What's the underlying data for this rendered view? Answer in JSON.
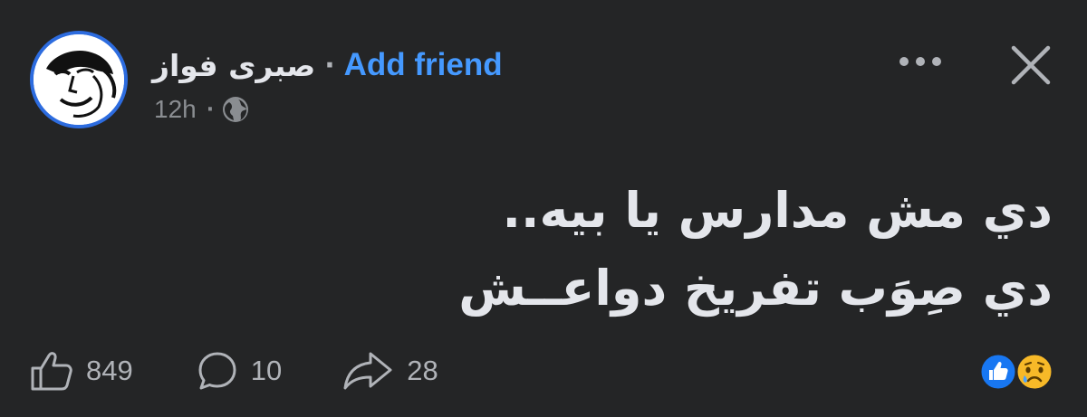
{
  "post": {
    "author_name": "صبرى فواز",
    "separator": "·",
    "add_friend_label": "Add friend",
    "time": "12h",
    "meta_separator": "·",
    "audience_icon": "globe-icon",
    "text_lines": [
      "دي مش مدارس يا بيه..",
      "دي صِوَب تفريخ دواعــش"
    ]
  },
  "header_actions": {
    "more_icon": "more-horizontal-icon",
    "close_icon": "close-icon"
  },
  "stats": {
    "likes": "849",
    "comments": "10",
    "shares": "28",
    "reactions": [
      "like-reaction-icon",
      "sad-reaction-icon"
    ]
  },
  "colors": {
    "background": "#242526",
    "text": "#e4e6eb",
    "muted": "#b0b3b8",
    "link": "#4599ff",
    "avatar_ring": "#2d6cdf",
    "like_blue": "#1877f2",
    "sad_yellow": "#f7b928"
  }
}
